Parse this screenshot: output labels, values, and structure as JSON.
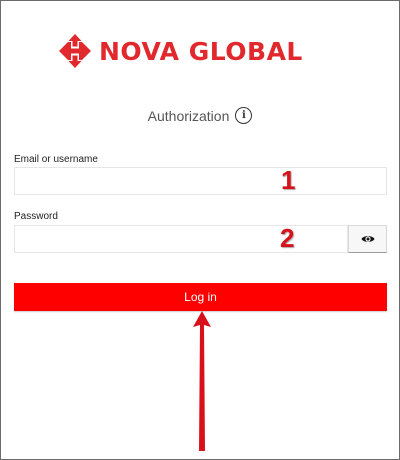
{
  "brand": {
    "name": "NOVA GLOBAL",
    "color": "#e0282d"
  },
  "auth": {
    "title": "Authorization",
    "info_icon": "info-icon"
  },
  "form": {
    "email_label": "Email or username",
    "email_value": "",
    "password_label": "Password",
    "password_value": "",
    "toggle_icon": "eye-icon",
    "login_label": "Log in",
    "login_color": "#ff0000"
  },
  "annotations": {
    "step1": "1",
    "step2": "2",
    "color": "#d8101a"
  }
}
